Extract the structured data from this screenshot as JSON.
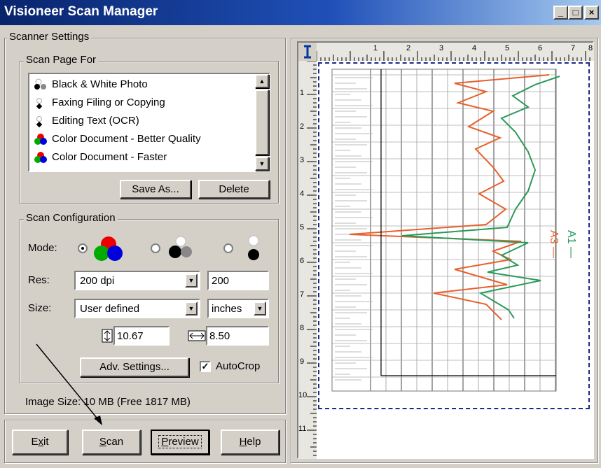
{
  "window": {
    "title": "Visioneer Scan Manager",
    "controls": {
      "minimize": "_",
      "maximize": "□",
      "close": "×"
    }
  },
  "scanner_settings": {
    "title": "Scanner Settings",
    "scan_page_for": {
      "title": "Scan Page For",
      "items": [
        {
          "label": "Black & White Photo",
          "icon": "bw-photo-icon"
        },
        {
          "label": "Faxing Filing or Copying",
          "icon": "fax-icon"
        },
        {
          "label": "Editing Text (OCR)",
          "icon": "ocr-icon"
        },
        {
          "label": "Color Document - Better Quality",
          "icon": "color-icon"
        },
        {
          "label": "Color Document - Faster",
          "icon": "color-icon"
        }
      ],
      "save_as_label": "Save As...",
      "delete_label": "Delete"
    },
    "scan_configuration": {
      "title": "Scan Configuration",
      "mode_label": "Mode:",
      "res_label": "Res:",
      "res_value": "200 dpi",
      "res_number": "200",
      "size_label": "Size:",
      "size_value": "User defined",
      "units_value": "inches",
      "height_value": "10.67",
      "width_value": "8.50",
      "adv_settings_label": "Adv. Settings...",
      "autocrop_label": "AutoCrop"
    },
    "image_size": "Image Size: 10 MB (Free 1817 MB)"
  },
  "buttons": {
    "exit": {
      "pre": "E",
      "u": "x",
      "post": "it"
    },
    "scan": {
      "pre": "",
      "u": "S",
      "post": "can"
    },
    "preview": {
      "pre": "",
      "u": "P",
      "post": "review"
    },
    "help": {
      "pre": "",
      "u": "H",
      "post": "elp"
    }
  },
  "ruler": {
    "top_numbers": [
      "1",
      "2",
      "3",
      "4",
      "5",
      "6",
      "7",
      "8"
    ],
    "left_numbers": [
      "1",
      "2",
      "3",
      "4",
      "5",
      "6",
      "7",
      "8",
      "9",
      "10",
      "11"
    ]
  },
  "preview": {
    "side_text_1": "A1 —",
    "side_text_2": "A3 —"
  },
  "colors": {
    "title_start": "#08246b",
    "title_end": "#a6caf0",
    "face": "#d4d0c8",
    "orange_trace": "#e8602c",
    "green_trace": "#2a9a5a"
  }
}
